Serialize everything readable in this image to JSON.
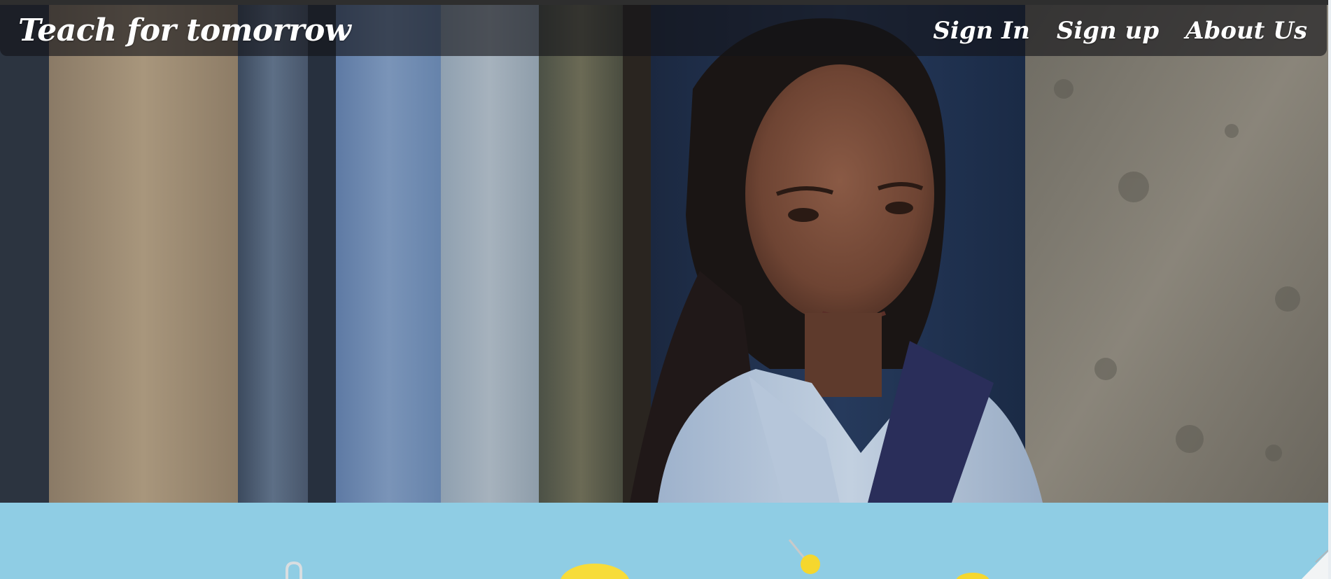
{
  "header": {
    "brand": "Teach for tomorrow",
    "nav": [
      {
        "label": "Sign In"
      },
      {
        "label": "Sign up"
      },
      {
        "label": "About Us"
      }
    ]
  }
}
